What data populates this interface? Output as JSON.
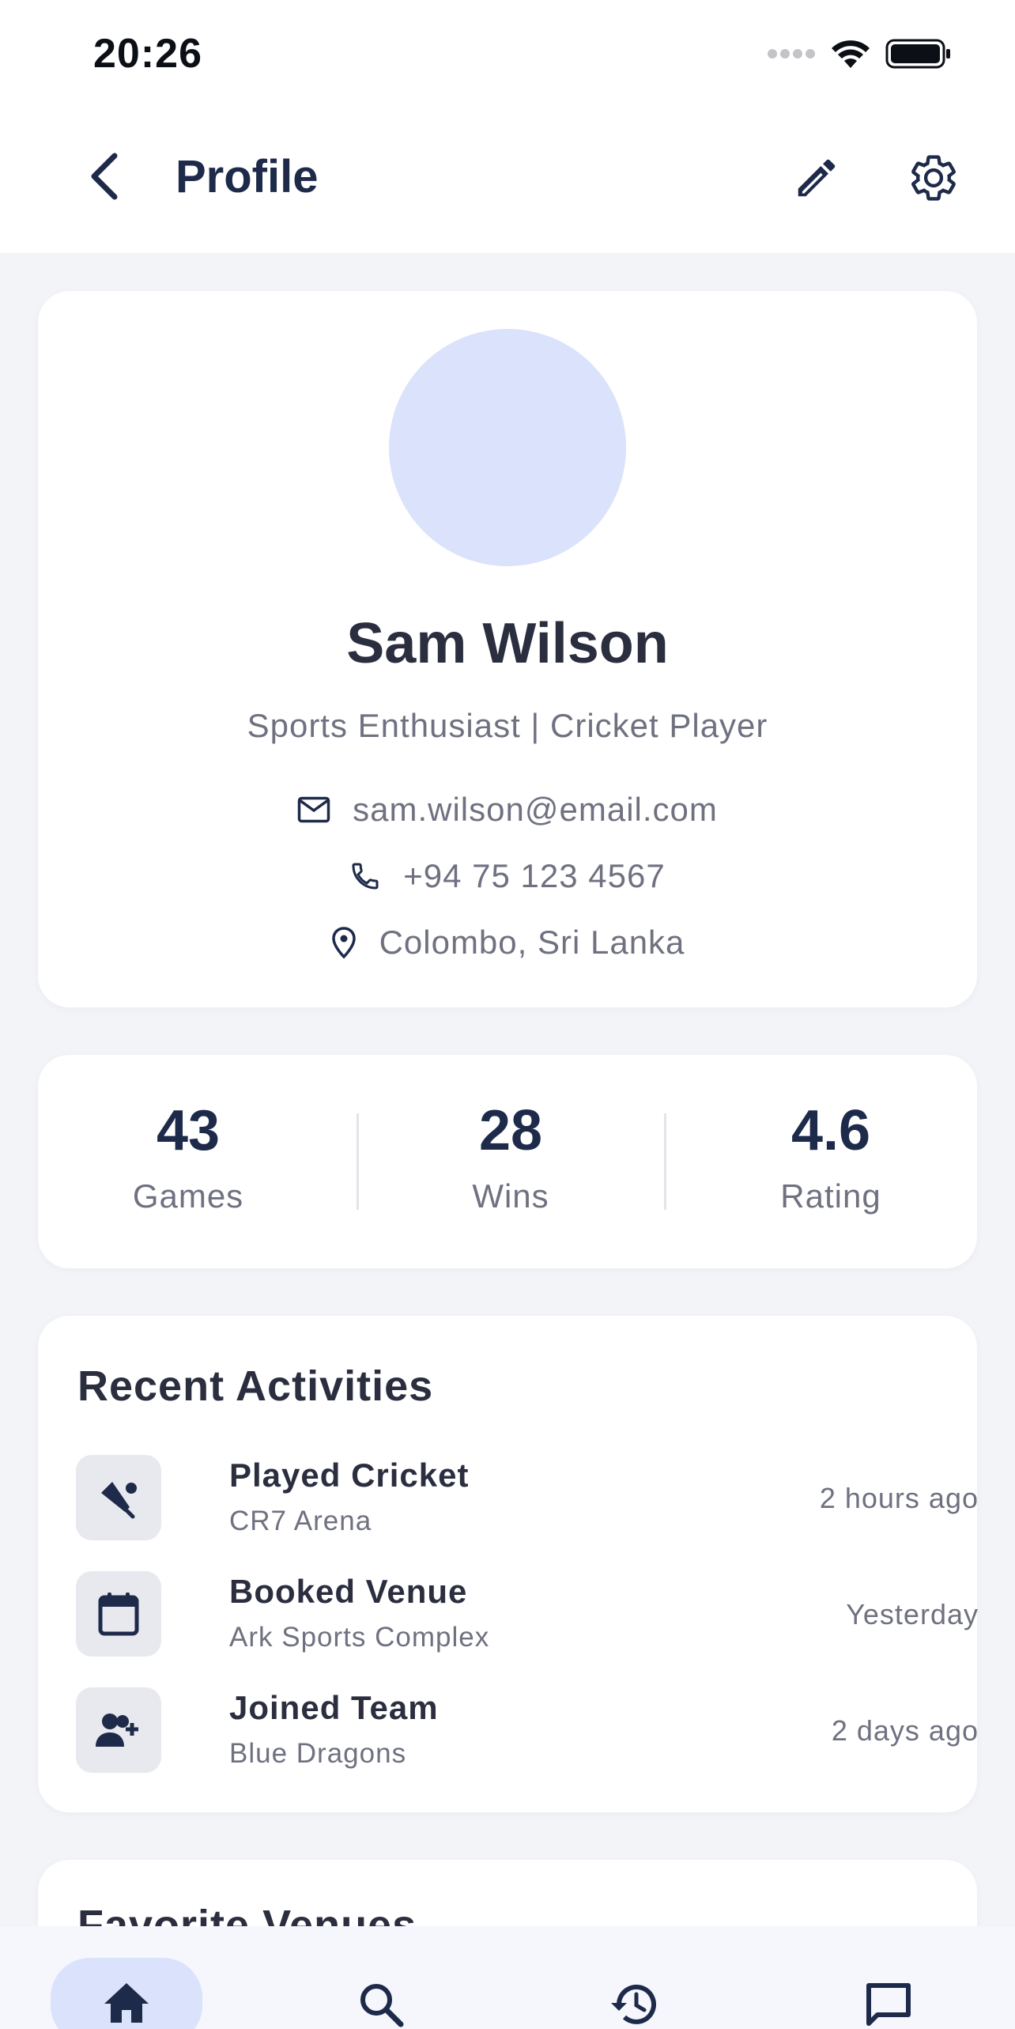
{
  "status_bar": {
    "time": "20:26"
  },
  "header": {
    "title": "Profile"
  },
  "profile": {
    "name": "Sam Wilson",
    "tagline": "Sports Enthusiast | Cricket Player",
    "email": "sam.wilson@email.com",
    "phone": "+94 75 123 4567",
    "location": "Colombo, Sri Lanka"
  },
  "stats": [
    {
      "value": "43",
      "label": "Games"
    },
    {
      "value": "28",
      "label": "Wins"
    },
    {
      "value": "4.6",
      "label": "Rating"
    }
  ],
  "activities": {
    "title": "Recent Activities",
    "items": [
      {
        "title": "Played Cricket",
        "subtitle": "CR7 Arena",
        "time": "2 hours ago",
        "icon": "cricket-icon"
      },
      {
        "title": "Booked Venue",
        "subtitle": "Ark Sports Complex",
        "time": "Yesterday",
        "icon": "calendar-icon"
      },
      {
        "title": "Joined Team",
        "subtitle": "Blue Dragons",
        "time": "2 days ago",
        "icon": "add-person-icon"
      }
    ]
  },
  "venues": {
    "title": "Favorite Venues"
  },
  "bottom_nav": [
    "home-icon",
    "search-icon",
    "history-icon",
    "chat-icon"
  ],
  "colors": {
    "primary": "#1e2a4a",
    "accent_soft": "#dbe2fb",
    "background": "#f3f4f8"
  }
}
